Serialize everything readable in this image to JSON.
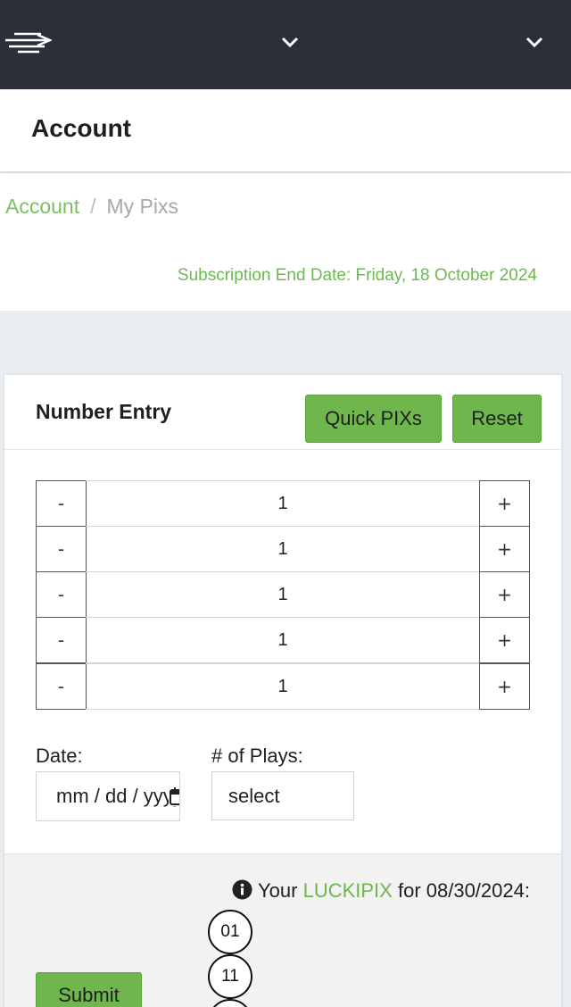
{
  "header": {
    "title": "Account",
    "menu_icon": "hamburger-menu-icon",
    "dropdown_icons": [
      "chevron-down-icon",
      "chevron-down-icon"
    ]
  },
  "breadcrumb": {
    "link": "Account",
    "separator": "/",
    "current": "My Pixs"
  },
  "subscription_end": "Subscription End Date: Friday, 18 October 2024",
  "number_entry": {
    "title": "Number Entry",
    "quick_label": "Quick PIXs",
    "reset_label": "Reset",
    "minus_label": "-",
    "plus_label": "+",
    "rows": [
      "1",
      "1",
      "1",
      "1",
      "1"
    ]
  },
  "form": {
    "date_label": "Date:",
    "date_placeholder": "mm / dd / yyyy",
    "plays_label": "# of Plays:",
    "plays_value": "select"
  },
  "result": {
    "prefix": "Your",
    "brand": "LUCKIPIX",
    "suffix": "for 08/30/2024:",
    "balls": [
      "01",
      "11",
      ""
    ]
  },
  "submit_label": "Submit",
  "colors": {
    "accent_green": "#6fb64d",
    "topbar": "#2b2f3a"
  }
}
